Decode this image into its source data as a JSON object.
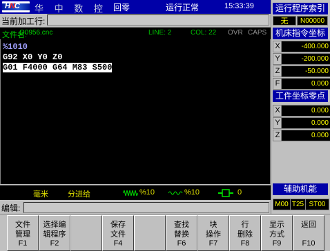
{
  "header": {
    "company": "华 中 数 控",
    "mode": "回零",
    "run_status": "运行正常",
    "time": "15:33:39"
  },
  "current_line": {
    "label": "当前加工行:",
    "value": ""
  },
  "file_bar": {
    "file_label": "文件名:",
    "file_name": "O0956.cnc",
    "line": "LINE: 2",
    "col": "COL: 22",
    "ovr": "OVR",
    "caps": "CAPS"
  },
  "editor": {
    "lines": [
      "%1010",
      "G92 X0 Y0 Z0",
      "G01 F4000 G64 M83 S500"
    ]
  },
  "status_bar": {
    "unit": "毫米",
    "feed_mode": "分进给",
    "feed_override": "%10",
    "spindle_override": "%10",
    "tool_label": "0"
  },
  "edit_line": {
    "label": "编辑:",
    "value": ""
  },
  "right_panel": {
    "prog_index_title": "运行程序索引",
    "prog_index_none": "无",
    "prog_index_num": "N00000",
    "machine_coord_title": "机床指令坐标",
    "machine_coords": [
      {
        "axis": "X",
        "value": "-400.000"
      },
      {
        "axis": "Y",
        "value": "-200.000"
      },
      {
        "axis": "Z",
        "value": "-50.000"
      },
      {
        "axis": "F",
        "value": "0.000"
      }
    ],
    "work_zero_title": "工件坐标零点",
    "work_zero": [
      {
        "axis": "X",
        "value": "0.000"
      },
      {
        "axis": "Y",
        "value": "0.000"
      },
      {
        "axis": "Z",
        "value": "0.000"
      }
    ],
    "aux_title": "辅助机能",
    "m_code": "M00",
    "t_code": "T25",
    "s_code": "ST00"
  },
  "function_keys": [
    {
      "l1": "文件",
      "l2": "管理",
      "fn": "F1"
    },
    {
      "l1": "选择编",
      "l2": "辑程序",
      "fn": "F2"
    },
    {
      "l1": "",
      "l2": "",
      "fn": ""
    },
    {
      "l1": "保存",
      "l2": "文件",
      "fn": "F4"
    },
    {
      "l1": "",
      "l2": "",
      "fn": ""
    },
    {
      "l1": "查找",
      "l2": "替换",
      "fn": "F6"
    },
    {
      "l1": "块",
      "l2": "操作",
      "fn": "F7"
    },
    {
      "l1": "行",
      "l2": "删除",
      "fn": "F8"
    },
    {
      "l1": "显示",
      "l2": "方式",
      "fn": "F9"
    },
    {
      "l1": "返回",
      "l2": "",
      "fn": "F10"
    }
  ],
  "colors": {
    "title_blue": "#0000a8",
    "value_yellow": "#ffff00",
    "file_green": "#00d000",
    "status_yellow": "#e0e000"
  }
}
